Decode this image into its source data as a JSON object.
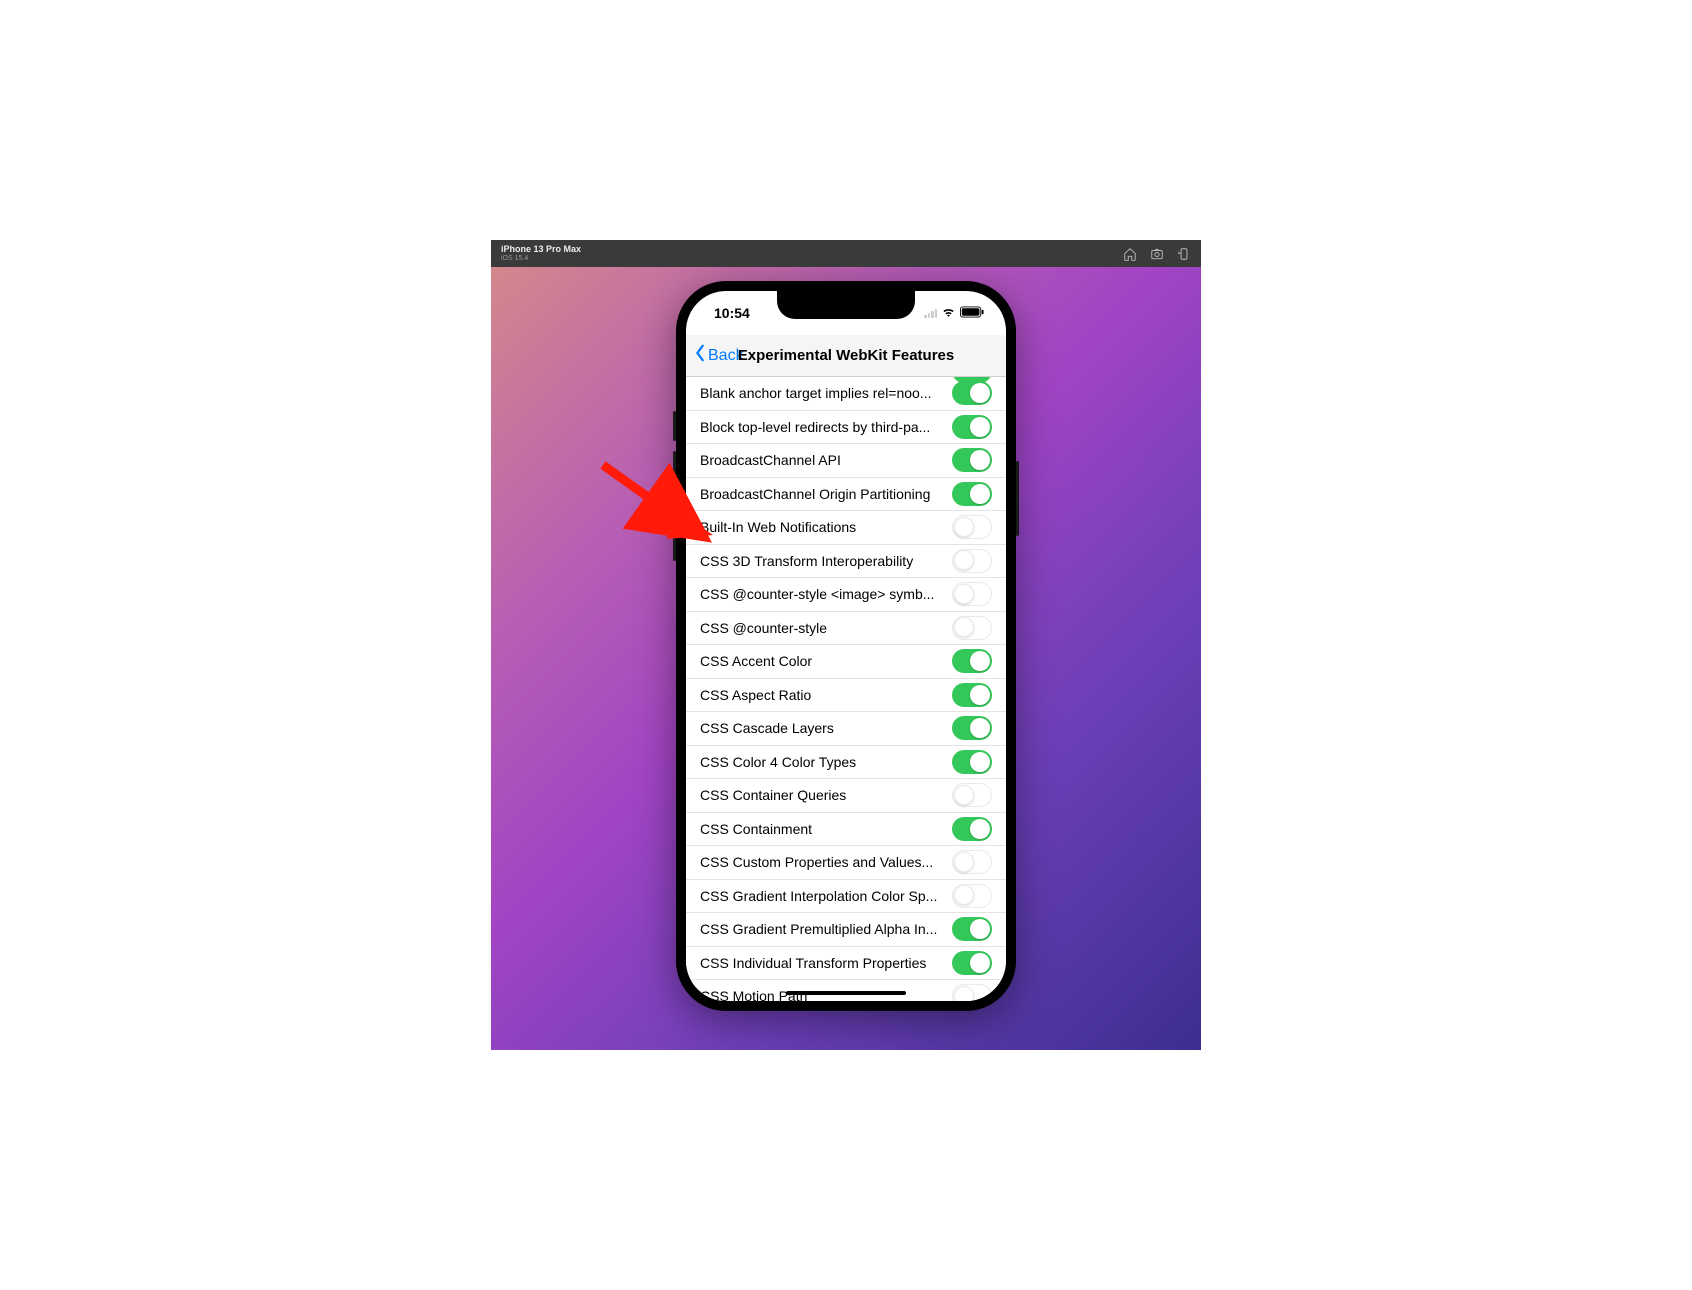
{
  "titlebar": {
    "device": "iPhone 13 Pro Max",
    "os": "iOS 15.4"
  },
  "status": {
    "time": "10:54"
  },
  "nav": {
    "back_label": "Back",
    "title": "Experimental WebKit Features"
  },
  "features": [
    {
      "label": "Blank anchor target implies rel=noo...",
      "on": true
    },
    {
      "label": "Block top-level redirects by third-pa...",
      "on": true
    },
    {
      "label": "BroadcastChannel API",
      "on": true
    },
    {
      "label": "BroadcastChannel Origin Partitioning",
      "on": true
    },
    {
      "label": "Built-In Web Notifications",
      "on": false
    },
    {
      "label": "CSS 3D Transform Interoperability",
      "on": false
    },
    {
      "label": "CSS @counter-style <image> symb...",
      "on": false
    },
    {
      "label": "CSS @counter-style",
      "on": false
    },
    {
      "label": "CSS Accent Color",
      "on": true
    },
    {
      "label": "CSS Aspect Ratio",
      "on": true
    },
    {
      "label": "CSS Cascade Layers",
      "on": true
    },
    {
      "label": "CSS Color 4 Color Types",
      "on": true
    },
    {
      "label": "CSS Container Queries",
      "on": false
    },
    {
      "label": "CSS Containment",
      "on": true
    },
    {
      "label": "CSS Custom Properties and Values...",
      "on": false
    },
    {
      "label": "CSS Gradient Interpolation Color Sp...",
      "on": false
    },
    {
      "label": "CSS Gradient Premultiplied Alpha In...",
      "on": true
    },
    {
      "label": "CSS Individual Transform Properties",
      "on": true
    },
    {
      "label": "CSS Motion Path",
      "on": false
    }
  ],
  "annotation": {
    "target_index": 4,
    "color": "#ff1a0a"
  }
}
